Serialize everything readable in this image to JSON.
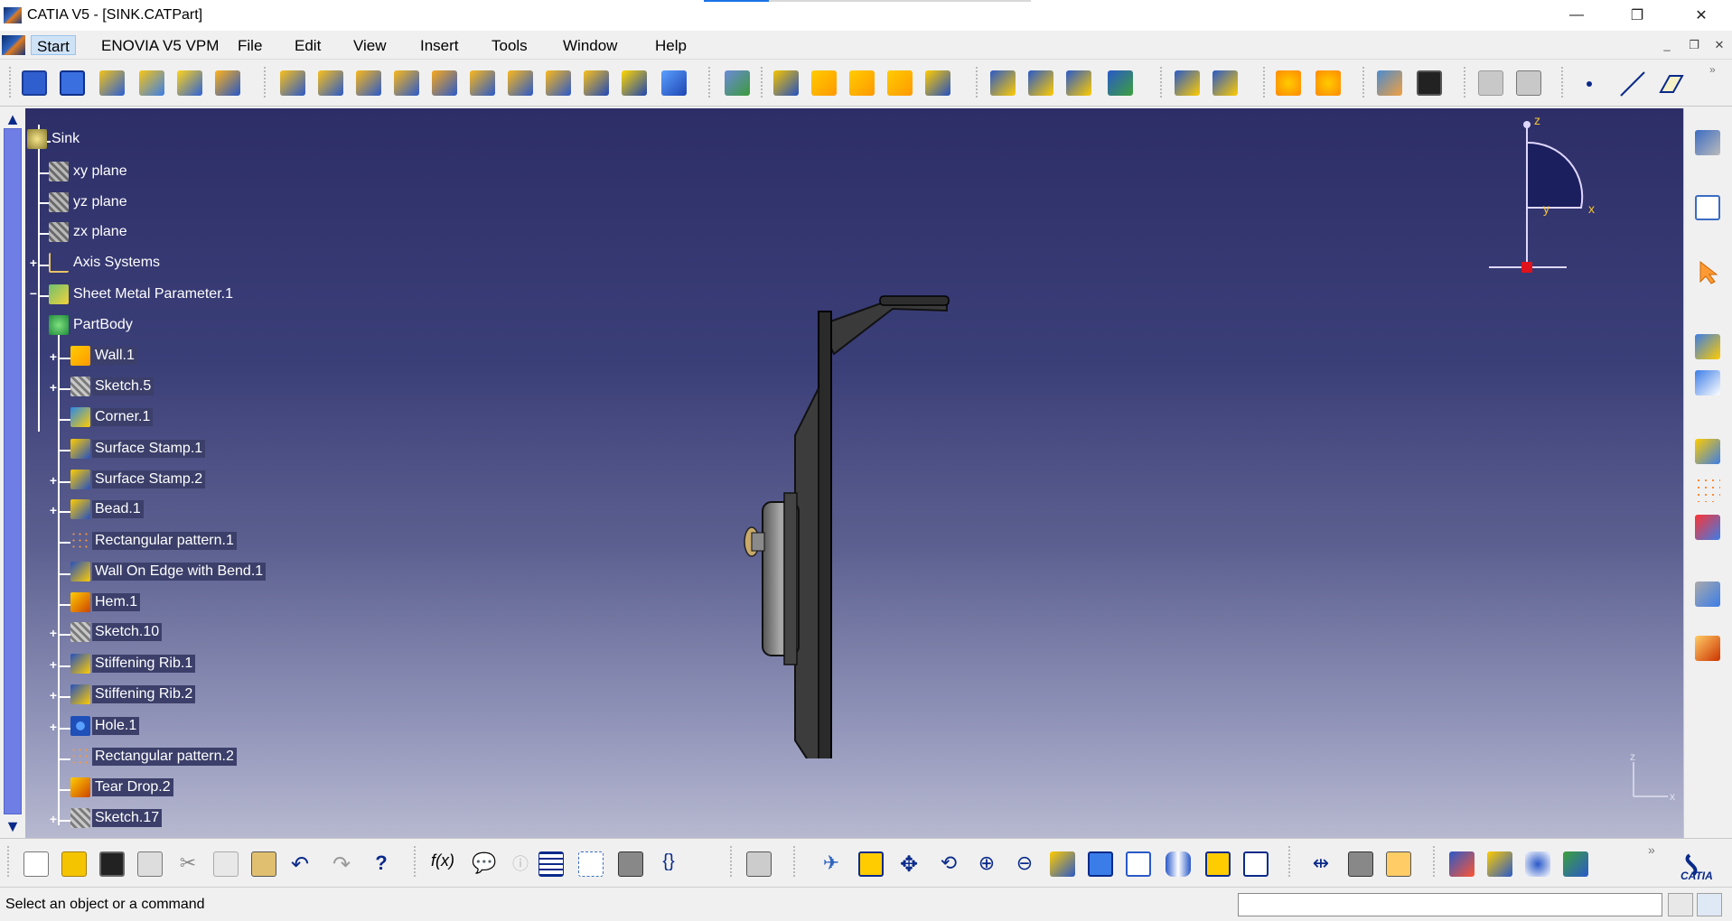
{
  "window": {
    "title": "CATIA V5 - [SINK.CATPart]",
    "controls": {
      "minimize": "—",
      "maximize": "❐",
      "close": "✕"
    }
  },
  "menu": {
    "items": [
      {
        "label": "Start",
        "active": true
      },
      {
        "label": "ENOVIA V5 VPM"
      },
      {
        "label": "File"
      },
      {
        "label": "Edit"
      },
      {
        "label": "View"
      },
      {
        "label": "Insert"
      },
      {
        "label": "Tools"
      },
      {
        "label": "Window"
      },
      {
        "label": "Help"
      }
    ],
    "doc_controls": {
      "minimize": "_",
      "restore": "❐",
      "close": "✕"
    }
  },
  "spec_tree": {
    "root": "Sink",
    "nodes": [
      {
        "label": "xy plane",
        "icon": "plane-icon"
      },
      {
        "label": "yz plane",
        "icon": "plane-icon"
      },
      {
        "label": "zx plane",
        "icon": "plane-icon"
      },
      {
        "label": "Axis Systems",
        "icon": "axis-system-icon",
        "expandable": true
      },
      {
        "label": "Sheet Metal Parameter.1",
        "icon": "sheet-metal-parameters-icon"
      },
      {
        "label": "PartBody",
        "icon": "partbody-icon",
        "expanded": true
      },
      {
        "label": "Wall.1",
        "icon": "wall-icon",
        "expandable": true
      },
      {
        "label": "Sketch.5",
        "icon": "sketch-icon",
        "expandable": true
      },
      {
        "label": "Corner.1",
        "icon": "corner-icon"
      },
      {
        "label": "Surface Stamp.1",
        "icon": "surface-stamp-icon"
      },
      {
        "label": "Surface Stamp.2",
        "icon": "surface-stamp-icon",
        "expandable": true
      },
      {
        "label": "Bead.1",
        "icon": "bead-icon",
        "expandable": true
      },
      {
        "label": "Rectangular pattern.1",
        "icon": "rectangular-pattern-icon"
      },
      {
        "label": "Wall On Edge with Bend.1",
        "icon": "wall-on-edge-icon"
      },
      {
        "label": "Hem.1",
        "icon": "hem-icon"
      },
      {
        "label": "Sketch.10",
        "icon": "sketch-icon",
        "expandable": true
      },
      {
        "label": "Stiffening Rib.1",
        "icon": "stiffening-rib-icon",
        "expandable": true
      },
      {
        "label": "Stiffening Rib.2",
        "icon": "stiffening-rib-icon",
        "expandable": true
      },
      {
        "label": "Hole.1",
        "icon": "hole-icon",
        "expandable": true
      },
      {
        "label": "Rectangular pattern.2",
        "icon": "rectangular-pattern-icon"
      },
      {
        "label": "Tear Drop.2",
        "icon": "tear-drop-icon"
      },
      {
        "label": "Sketch.17",
        "icon": "sketch-icon",
        "expandable": true
      }
    ]
  },
  "compass": {
    "z": "z",
    "x": "x",
    "y": "y"
  },
  "axis_triad": {
    "z": "z",
    "x": "x"
  },
  "status": {
    "message": "Select an object or a command",
    "command_input": ""
  },
  "brand": {
    "logo_text": "CATIA"
  },
  "colors": {
    "viewport_top": "#2d2e68",
    "viewport_bottom": "#b7b9d0",
    "tree_text": "#ffffff",
    "scroll_thumb": "#6f7ee4",
    "accent": "#1a73e8"
  }
}
